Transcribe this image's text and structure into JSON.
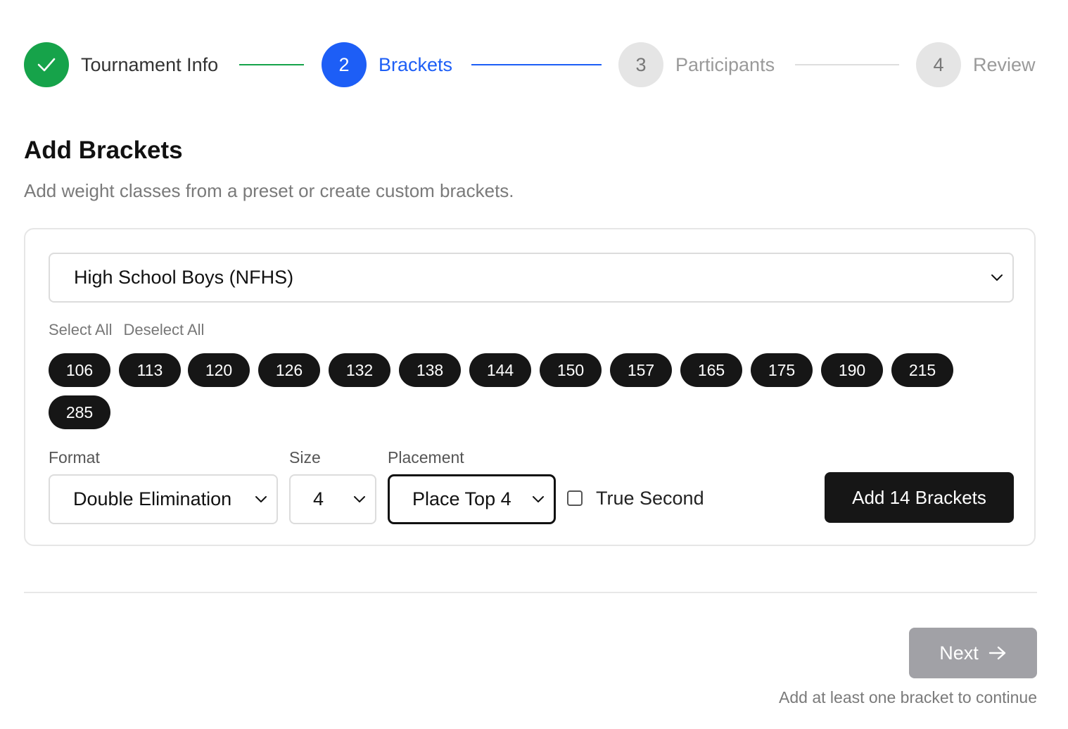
{
  "stepper": {
    "steps": [
      {
        "number": "",
        "label": "Tournament Info",
        "state": "done"
      },
      {
        "number": "2",
        "label": "Brackets",
        "state": "active"
      },
      {
        "number": "3",
        "label": "Participants",
        "state": "todo"
      },
      {
        "number": "4",
        "label": "Review",
        "state": "todo"
      }
    ]
  },
  "header": {
    "title": "Add Brackets",
    "subtitle": "Add weight classes from a preset or create custom brackets."
  },
  "card": {
    "preset_select": {
      "value": "High School Boys (NFHS)"
    },
    "select_all": "Select All",
    "deselect_all": "Deselect All",
    "weights": [
      "106",
      "113",
      "120",
      "126",
      "132",
      "138",
      "144",
      "150",
      "157",
      "165",
      "175",
      "190",
      "215",
      "285"
    ],
    "format": {
      "label": "Format",
      "value": "Double Elimination"
    },
    "size": {
      "label": "Size",
      "value": "4"
    },
    "placement": {
      "label": "Placement",
      "value": "Place Top 4"
    },
    "true_second": {
      "label": "True Second",
      "checked": false
    },
    "add_button": "Add 14 Brackets"
  },
  "footer": {
    "next_button": "Next",
    "hint": "Add at least one bracket to continue"
  },
  "colors": {
    "success": "#16a34a",
    "primary": "#1d5ef6",
    "dark": "#161616",
    "disabled": "#a1a1a6"
  }
}
